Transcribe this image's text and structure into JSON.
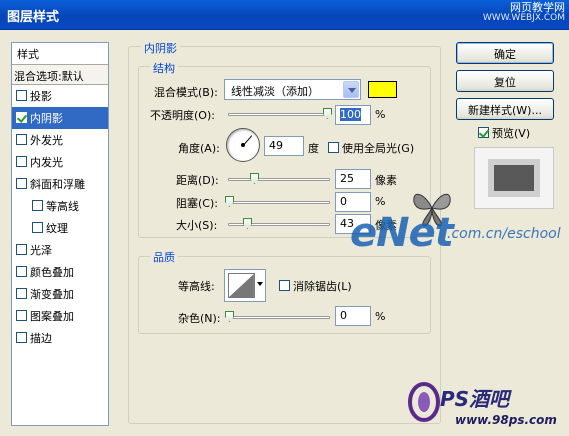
{
  "window": {
    "title": "图层样式"
  },
  "watermark_top": {
    "line1": "网页教学网",
    "line2": "WWW.WEBJX.COM"
  },
  "styles_panel": {
    "header": "样式",
    "blend_options": "混合选项:默认",
    "items": [
      {
        "label": "投影",
        "checked": false,
        "sub": false,
        "selected": false
      },
      {
        "label": "内阴影",
        "checked": true,
        "sub": false,
        "selected": true
      },
      {
        "label": "外发光",
        "checked": false,
        "sub": false,
        "selected": false
      },
      {
        "label": "内发光",
        "checked": false,
        "sub": false,
        "selected": false
      },
      {
        "label": "斜面和浮雕",
        "checked": false,
        "sub": false,
        "selected": false
      },
      {
        "label": "等高线",
        "checked": false,
        "sub": true,
        "selected": false
      },
      {
        "label": "纹理",
        "checked": false,
        "sub": true,
        "selected": false
      },
      {
        "label": "光泽",
        "checked": false,
        "sub": false,
        "selected": false
      },
      {
        "label": "颜色叠加",
        "checked": false,
        "sub": false,
        "selected": false
      },
      {
        "label": "渐变叠加",
        "checked": false,
        "sub": false,
        "selected": false
      },
      {
        "label": "图案叠加",
        "checked": false,
        "sub": false,
        "selected": false
      },
      {
        "label": "描边",
        "checked": false,
        "sub": false,
        "selected": false
      }
    ]
  },
  "inner_shadow": {
    "group_title": "内阴影",
    "structure": {
      "title": "结构",
      "blend_mode_label": "混合模式(B):",
      "blend_mode_value": "线性减淡（添加）",
      "color": "#ffff00",
      "opacity_label": "不透明度(O):",
      "opacity_value": "100",
      "opacity_unit": "%",
      "angle_label": "角度(A):",
      "angle_value": "49",
      "angle_unit": "度",
      "global_light_label": "使用全局光(G)",
      "global_light_checked": false,
      "distance_label": "距离(D):",
      "distance_value": "25",
      "distance_unit": "像素",
      "choke_label": "阻塞(C):",
      "choke_value": "0",
      "choke_unit": "%",
      "size_label": "大小(S):",
      "size_value": "43",
      "size_unit": "像素"
    },
    "quality": {
      "title": "品质",
      "contour_label": "等高线:",
      "antialias_label": "消除锯齿(L)",
      "antialias_checked": false,
      "noise_label": "杂色(N):",
      "noise_value": "0",
      "noise_unit": "%"
    }
  },
  "buttons": {
    "ok": "确定",
    "reset": "复位",
    "new_style": "新建样式(W)...",
    "preview": "预览(V)",
    "preview_checked": true
  },
  "watermarks": {
    "enet": "eNet",
    "enet_url": ".com.cn/eschool",
    "ps": "PS酒吧",
    "ps_url": "www.98ps.com"
  }
}
